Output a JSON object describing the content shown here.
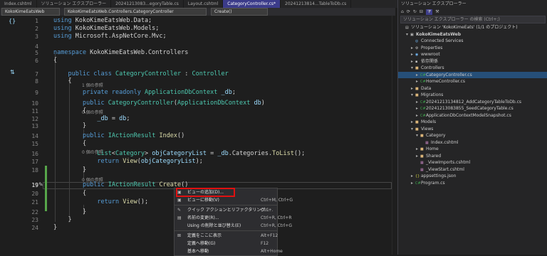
{
  "tabs": [
    {
      "label": "Index.cshtml",
      "active": false
    },
    {
      "label": "ソリューション エクスプローラー",
      "active": false
    },
    {
      "label": "20241213083...egoryTable.cs",
      "active": false
    },
    {
      "label": "Layout.cshtml",
      "active": false
    },
    {
      "label": "CategoryController.cs*",
      "active": true
    },
    {
      "label": "20241213814...TableToDb.cs",
      "active": false
    }
  ],
  "nav": {
    "project": "KokoKimeEatsWeb",
    "class": "KokoKimeEatsWeb.Controllers.CategoryController",
    "member": "Create()"
  },
  "code_lines": [
    {
      "num": "1",
      "html": "<span class='kw'>using</span> KokoKimeEatsWeb.Data;"
    },
    {
      "num": "2",
      "html": "<span class='kw'>using</span> KokoKimeEatsWeb.Models;"
    },
    {
      "num": "3",
      "html": "<span class='kw'>using</span> Microsoft.AspNetCore.Mvc;"
    },
    {
      "num": "4",
      "html": ""
    },
    {
      "num": "5",
      "html": "<span class='kw'>namespace</span> KokoKimeEatsWeb.Controllers"
    },
    {
      "num": "6",
      "html": "{"
    },
    {
      "num": "7",
      "html": "    <span class='kw'>public class</span> <span class='ty'>CategoryController</span> : <span class='ty'>Controller</span>"
    },
    {
      "num": "8",
      "html": "    {"
    },
    {
      "num": "9",
      "html": "        <span class='kw'>private readonly</span> <span class='ty'>ApplicationDbContext</span> <span class='vr'>_db</span>;"
    },
    {
      "num": "10",
      "html": "        <span class='kw'>public</span> <span class='ty'>CategoryController</span>(<span class='ty'>ApplicationDbContext</span> <span class='pm'>db</span>)"
    },
    {
      "num": "11",
      "html": "        {"
    },
    {
      "num": "12",
      "html": "            <span class='vr'>_db</span> = <span class='pm'>db</span>;"
    },
    {
      "num": "13",
      "html": "        }"
    },
    {
      "num": "14",
      "html": "        <span class='kw'>public</span> <span class='ty'>IActionResult</span> <span class='fn'>Index</span>()"
    },
    {
      "num": "15",
      "html": "        {"
    },
    {
      "num": "16",
      "html": "            <span class='ty'>List</span>&lt;<span class='ty'>Category</span>&gt; <span class='vr'>objCategoryList</span> = <span class='vr'>_db</span>.Categories.<span class='fn'>ToList</span>();"
    },
    {
      "num": "17",
      "html": "            <span class='kw'>return</span> <span class='fn'>View</span>(<span class='vr'>objCategoryList</span>);"
    },
    {
      "num": "18",
      "html": "        }"
    },
    {
      "num": "19",
      "html": "        <span class='kw'>public</span> <span class='ty'>IActionResult</span> <span class='fn'>Create</span>()"
    },
    {
      "num": "20",
      "html": "        {"
    },
    {
      "num": "21",
      "html": "            <span class='kw'>return</span> <span class='fn'>View</span>();"
    },
    {
      "num": "22",
      "html": "        }"
    },
    {
      "num": "23",
      "html": "    }"
    },
    {
      "num": "24",
      "html": "}"
    }
  ],
  "refs": {
    "r7": "1 個の参照",
    "r9": "0 個の参照",
    "r14": "0 個の参照",
    "r19": "0 個の参照"
  },
  "context_menu": [
    {
      "label": "ビューの追加(D)...",
      "shortcut": "",
      "icon": "▣"
    },
    {
      "label": "ビューに移動(V)",
      "shortcut": "Ctrl+M, Ctrl+G",
      "icon": "▣"
    },
    {
      "sep": true
    },
    {
      "label": "クイック アクションとリファクタリング...",
      "shortcut": "Ctrl+.",
      "icon": "✎"
    },
    {
      "label": "名前の変更(R)...",
      "shortcut": "Ctrl+R, Ctrl+R",
      "icon": "▤"
    },
    {
      "label": "Using の削除と並び替え(E)",
      "shortcut": "Ctrl+R, Ctrl+G",
      "icon": ""
    },
    {
      "sep": true
    },
    {
      "label": "定義をここに表示",
      "shortcut": "Alt+F12",
      "icon": "⊠"
    },
    {
      "label": "定義へ移動(G)",
      "shortcut": "F12",
      "icon": ""
    },
    {
      "label": "基本へ移動",
      "shortcut": "Alt+Home",
      "icon": ""
    }
  ],
  "solution_explorer": {
    "title": "ソリューション エクスプローラー",
    "search_placeholder": "ソリューション エクスプローラー の検索 (Ctrl+;)",
    "tree": [
      {
        "indent": 0,
        "arrow": "",
        "icon": "▤",
        "label": "ソリューション 'KokoKimeEats' (1/1 のプロジェクト)",
        "color": "#c5c5c5"
      },
      {
        "indent": 1,
        "arrow": "▾",
        "icon": "▣",
        "label": "KokoKimeEatsWeb",
        "color": "#c5c5c5",
        "bold": true
      },
      {
        "indent": 2,
        "arrow": "",
        "icon": "◎",
        "label": "Connected Services",
        "color": "#75beff"
      },
      {
        "indent": 2,
        "arrow": "▸",
        "icon": "⚙",
        "label": "Properties",
        "color": "#c5c5c5"
      },
      {
        "indent": 2,
        "arrow": "▸",
        "icon": "◉",
        "label": "wwwroot",
        "color": "#75beff"
      },
      {
        "indent": 2,
        "arrow": "▸",
        "icon": "▪",
        "label": "依存関係",
        "color": "#c5c5c5"
      },
      {
        "indent": 2,
        "arrow": "▾",
        "icon": "■",
        "label": "Controllers",
        "color": "#dcb67a"
      },
      {
        "indent": 3,
        "arrow": "▸",
        "icon": "C#",
        "label": "CategoryController.cs",
        "color": "#3fa34d",
        "selected": true
      },
      {
        "indent": 3,
        "arrow": "▸",
        "icon": "C#",
        "label": "HomeController.cs",
        "color": "#3fa34d"
      },
      {
        "indent": 2,
        "arrow": "▸",
        "icon": "■",
        "label": "Data",
        "color": "#dcb67a"
      },
      {
        "indent": 2,
        "arrow": "▾",
        "icon": "■",
        "label": "Migrations",
        "color": "#dcb67a"
      },
      {
        "indent": 3,
        "arrow": "▸",
        "icon": "C#",
        "label": "20241213134812_AddCategoryTableToDb.cs",
        "color": "#3fa34d"
      },
      {
        "indent": 3,
        "arrow": "▸",
        "icon": "C#",
        "label": "20241213083855_SeedCategoryTable.cs",
        "color": "#3fa34d"
      },
      {
        "indent": 3,
        "arrow": "▸",
        "icon": "C#",
        "label": "ApplicationDbContextModelSnapshot.cs",
        "color": "#3fa34d"
      },
      {
        "indent": 2,
        "arrow": "▸",
        "icon": "■",
        "label": "Models",
        "color": "#dcb67a"
      },
      {
        "indent": 2,
        "arrow": "▾",
        "icon": "■",
        "label": "Views",
        "color": "#dcb67a"
      },
      {
        "indent": 3,
        "arrow": "▾",
        "icon": "■",
        "label": "Category",
        "color": "#dcb67a"
      },
      {
        "indent": 4,
        "arrow": "",
        "icon": "▦",
        "label": "Index.cshtml",
        "color": "#c586c0"
      },
      {
        "indent": 3,
        "arrow": "▸",
        "icon": "■",
        "label": "Home",
        "color": "#dcb67a"
      },
      {
        "indent": 3,
        "arrow": "▸",
        "icon": "■",
        "label": "Shared",
        "color": "#dcb67a"
      },
      {
        "indent": 3,
        "arrow": "",
        "icon": "▦",
        "label": "_ViewImports.cshtml",
        "color": "#c586c0"
      },
      {
        "indent": 3,
        "arrow": "",
        "icon": "▦",
        "label": "_ViewStart.cshtml",
        "color": "#c586c0"
      },
      {
        "indent": 2,
        "arrow": "▸",
        "icon": "{}",
        "label": "appsettings.json",
        "color": "#cbcb41"
      },
      {
        "indent": 2,
        "arrow": "▸",
        "icon": "C#",
        "label": "Program.cs",
        "color": "#3fa34d"
      }
    ]
  }
}
